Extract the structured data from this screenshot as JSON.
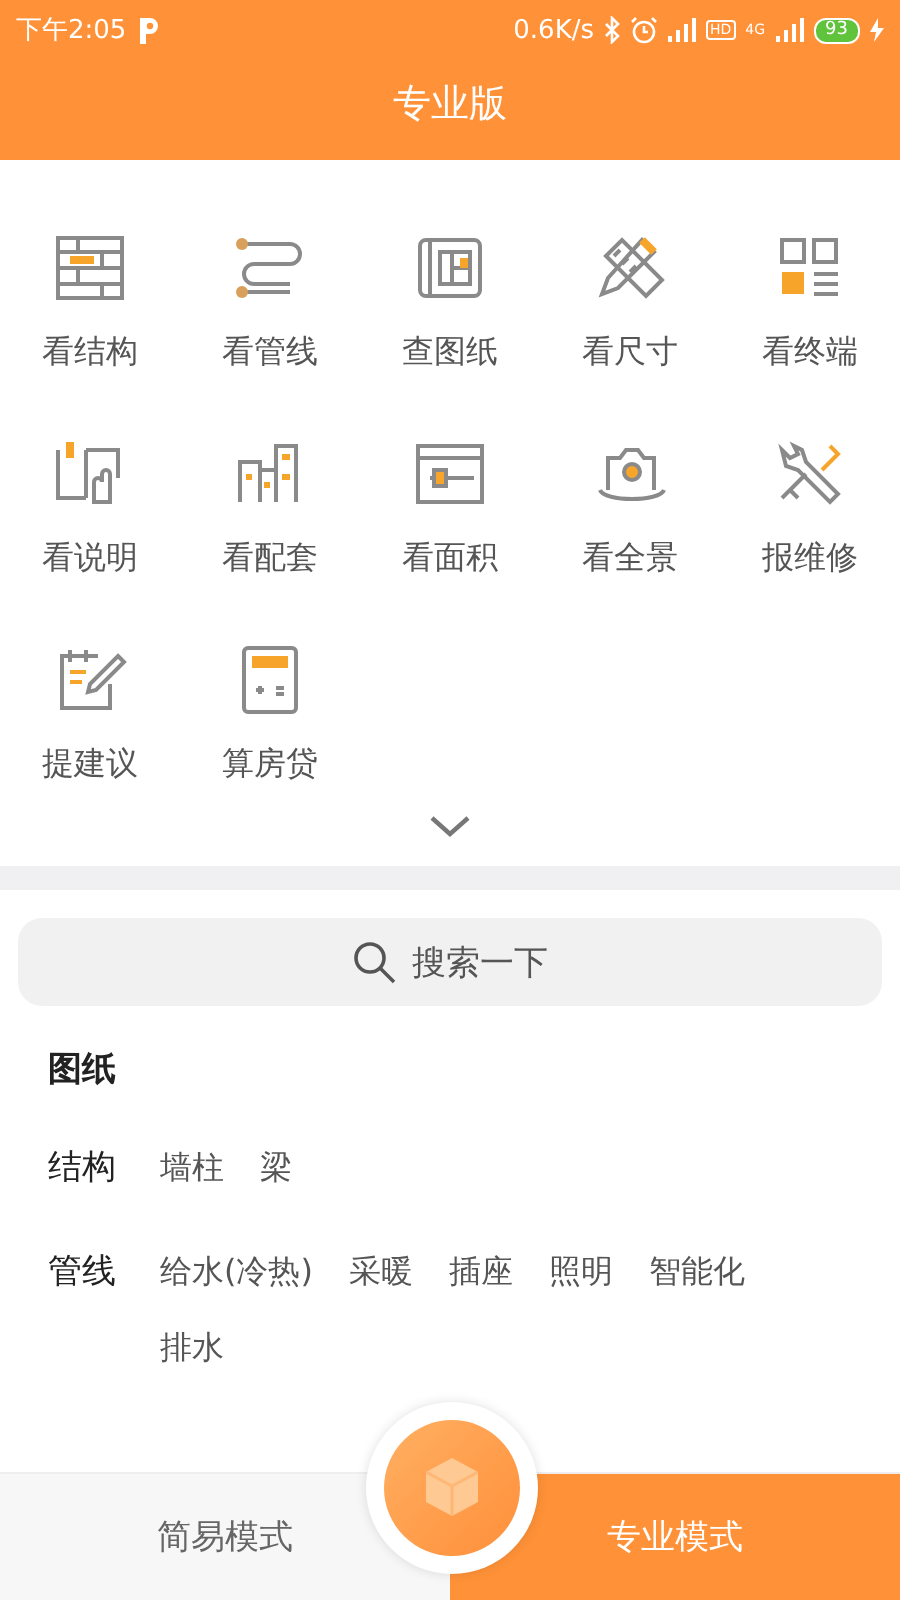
{
  "status_bar": {
    "time": "下午2:05",
    "speed": "0.6K/s",
    "hd": "HD",
    "network": "4G",
    "battery": "93"
  },
  "title": "专业版",
  "features": [
    {
      "label": "看结构",
      "kind": "wall"
    },
    {
      "label": "看管线",
      "kind": "pipe"
    },
    {
      "label": "查图纸",
      "kind": "blueprint"
    },
    {
      "label": "看尺寸",
      "kind": "ruler"
    },
    {
      "label": "看终端",
      "kind": "grid"
    },
    {
      "label": "看说明",
      "kind": "book"
    },
    {
      "label": "看配套",
      "kind": "buildings"
    },
    {
      "label": "看面积",
      "kind": "area"
    },
    {
      "label": "看全景",
      "kind": "camera"
    },
    {
      "label": "报维修",
      "kind": "tools"
    },
    {
      "label": "提建议",
      "kind": "note"
    },
    {
      "label": "算房贷",
      "kind": "calculator"
    }
  ],
  "search": {
    "placeholder": "搜索一下"
  },
  "section_title": "图纸",
  "categories": [
    {
      "name": "结构",
      "tags": [
        "墙柱",
        "梁"
      ]
    },
    {
      "name": "管线",
      "tags": [
        "给水(冷热)",
        "采暖",
        "插座",
        "照明",
        "智能化",
        "排水"
      ]
    }
  ],
  "bottom_tabs": [
    {
      "label": "简易模式",
      "selected": false
    },
    {
      "label": "专业模式",
      "selected": true
    }
  ]
}
